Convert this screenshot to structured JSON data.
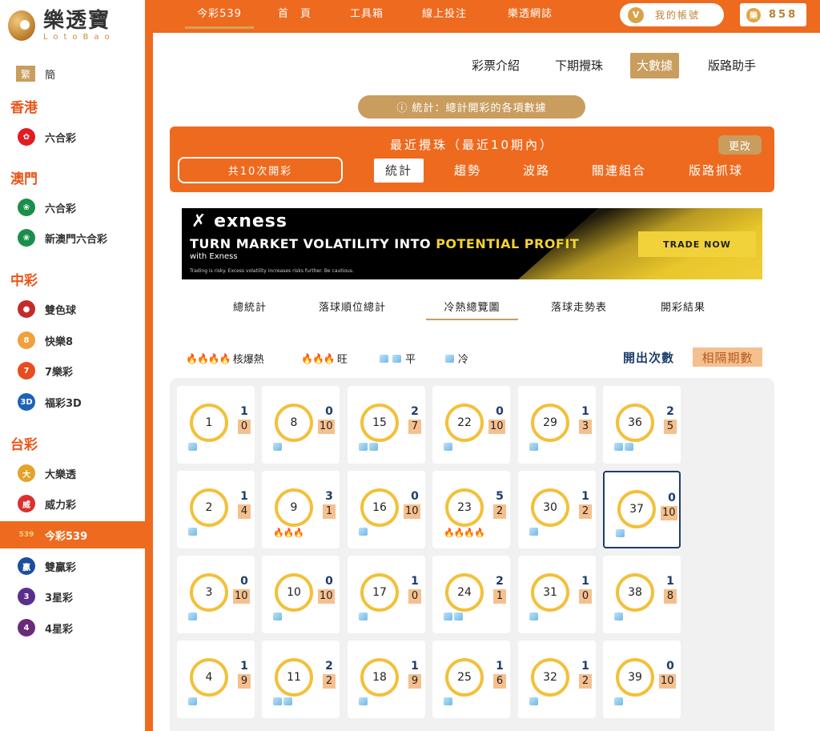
{
  "brand": {
    "title": "樂透寶",
    "subtitle": "LotoBao"
  },
  "lang": {
    "traditional": "繁",
    "simplified": "簡"
  },
  "sidebar": {
    "regions": [
      {
        "label": "香港",
        "items": [
          {
            "label": "六合彩",
            "color": "#e21c23"
          }
        ]
      },
      {
        "label": "澳門",
        "items": [
          {
            "label": "六合彩",
            "color": "#1a8f4a"
          },
          {
            "label": "新澳門六合彩",
            "color": "#1a8f4a"
          }
        ]
      },
      {
        "label": "中彩",
        "items": [
          {
            "label": "雙色球",
            "color": "#c52a2a"
          },
          {
            "label": "快樂8",
            "color": "#f0a13a"
          },
          {
            "label": "7樂彩",
            "color": "#e84c1f"
          },
          {
            "label": "福彩3D",
            "color": "#1c63b7"
          }
        ]
      },
      {
        "label": "台彩",
        "items": [
          {
            "label": "大樂透",
            "color": "#e3a32a"
          },
          {
            "label": "威力彩",
            "color": "#d93030"
          },
          {
            "label": "今彩539",
            "color": "#d8a24b"
          },
          {
            "label": "雙贏彩",
            "color": "#1a4f9c"
          },
          {
            "label": "3星彩",
            "color": "#5a2f8c"
          },
          {
            "label": "4星彩",
            "color": "#6a2c7a"
          }
        ]
      }
    ]
  },
  "topnav": {
    "items": [
      "今彩539",
      "首　頁",
      "工具箱",
      "線上投注",
      "樂透網誌"
    ],
    "account": "我的帳號",
    "account_badge": "V",
    "coins": "858",
    "coin_badge": "樂"
  },
  "subnav": [
    "彩票介紹",
    "下期攪珠",
    "大數據",
    "版路助手"
  ],
  "info": "ⓘ 統計：總計開彩的各項數據",
  "panel": {
    "title": "最近攪珠（最近10期內）",
    "change": "更改",
    "count": "共10次開彩",
    "tabs": [
      "統計",
      "趨勢",
      "波路",
      "關連組合",
      "版路抓球"
    ]
  },
  "ad": {
    "logo": "exness",
    "headline_pre": "TURN MARKET VOLATILITY INTO ",
    "headline_hl": "POTENTIAL PROFIT",
    "sub": "with Exness",
    "disclaimer": "Trading is risky. Excess volatility increases risks further. Be cautious.",
    "cta": "TRADE NOW"
  },
  "content_tabs": [
    "總統計",
    "落球順位總計",
    "冷熱總覽圖",
    "落球走勢表",
    "開彩結果"
  ],
  "legend": {
    "hot": "核爆熱",
    "warm": "旺",
    "flat": "平",
    "cold": "冷",
    "toggle_count": "開出次數",
    "toggle_gap": "相隔期數"
  },
  "grid": [
    {
      "n": "1",
      "count": "1",
      "gap": "0",
      "heat": "ice1"
    },
    {
      "n": "8",
      "count": "0",
      "gap": "10",
      "heat": "ice1"
    },
    {
      "n": "15",
      "count": "2",
      "gap": "7",
      "heat": "ice2"
    },
    {
      "n": "22",
      "count": "0",
      "gap": "10",
      "heat": "ice1"
    },
    {
      "n": "29",
      "count": "1",
      "gap": "3",
      "heat": "ice1"
    },
    {
      "n": "36",
      "count": "2",
      "gap": "5",
      "heat": "ice2"
    },
    {
      "n": "2",
      "count": "1",
      "gap": "4",
      "heat": "ice1"
    },
    {
      "n": "9",
      "count": "3",
      "gap": "1",
      "heat": "fire3"
    },
    {
      "n": "16",
      "count": "0",
      "gap": "10",
      "heat": "ice1"
    },
    {
      "n": "23",
      "count": "5",
      "gap": "2",
      "heat": "fire4"
    },
    {
      "n": "30",
      "count": "1",
      "gap": "2",
      "heat": "ice1"
    },
    {
      "n": "37",
      "count": "0",
      "gap": "10",
      "heat": "ice1",
      "highlight": true
    },
    {
      "n": "3",
      "count": "0",
      "gap": "10",
      "heat": "ice1"
    },
    {
      "n": "10",
      "count": "0",
      "gap": "10",
      "heat": "ice1"
    },
    {
      "n": "17",
      "count": "1",
      "gap": "0",
      "heat": "ice1"
    },
    {
      "n": "24",
      "count": "2",
      "gap": "1",
      "heat": "ice2"
    },
    {
      "n": "31",
      "count": "1",
      "gap": "0",
      "heat": "ice1"
    },
    {
      "n": "38",
      "count": "1",
      "gap": "8",
      "heat": "ice1"
    },
    {
      "n": "4",
      "count": "1",
      "gap": "9",
      "heat": "ice1"
    },
    {
      "n": "11",
      "count": "2",
      "gap": "2",
      "heat": "ice2"
    },
    {
      "n": "18",
      "count": "1",
      "gap": "9",
      "heat": "ice1"
    },
    {
      "n": "25",
      "count": "1",
      "gap": "6",
      "heat": "ice1"
    },
    {
      "n": "32",
      "count": "1",
      "gap": "2",
      "heat": "ice1"
    },
    {
      "n": "39",
      "count": "0",
      "gap": "10",
      "heat": "ice1"
    }
  ]
}
